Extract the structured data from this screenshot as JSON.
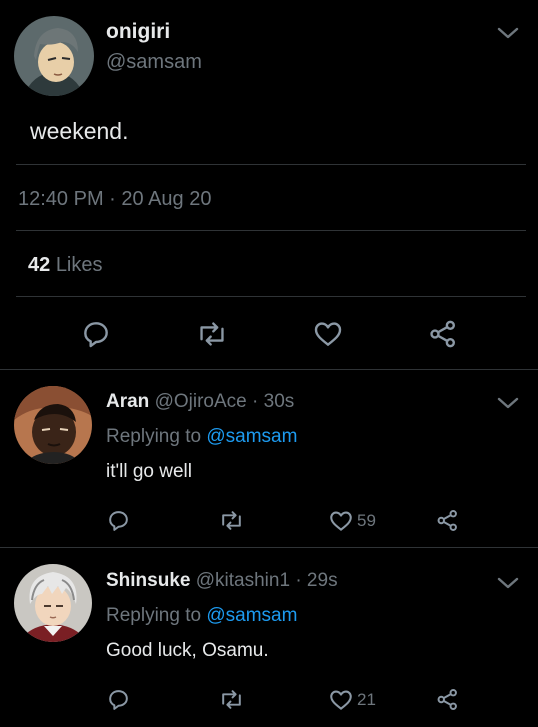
{
  "main_tweet": {
    "display_name": "onigiri",
    "handle": "@samsam",
    "text": "weekend.",
    "timestamp": "12:40 PM · 20 Aug 20",
    "likes_count": "42",
    "likes_label": "Likes",
    "avatar_icon": "anime-boy-avatar",
    "actions": [
      "reply-icon",
      "retweet-icon",
      "like-icon",
      "share-icon"
    ]
  },
  "replies": [
    {
      "display_name": "Aran",
      "handle": "@OjiroAce",
      "time": "· 30s",
      "replying_prefix": "Replying to",
      "replying_to": "@samsam",
      "text": "it'll go well",
      "like_count": "59",
      "avatar_icon": "dark-skinned-anime-boy-avatar"
    },
    {
      "display_name": "Shinsuke",
      "handle": "@kitashin1",
      "time": "· 29s",
      "replying_prefix": "Replying to",
      "replying_to": "@samsam",
      "text": "Good luck, Osamu.",
      "like_count": "21",
      "avatar_icon": "grey-haired-anime-boy-avatar"
    }
  ],
  "colors": {
    "background": "#000000",
    "text": "#e7e9ea",
    "muted": "#6e767d",
    "accent": "#1d9bf0",
    "divider": "#2f3336"
  }
}
